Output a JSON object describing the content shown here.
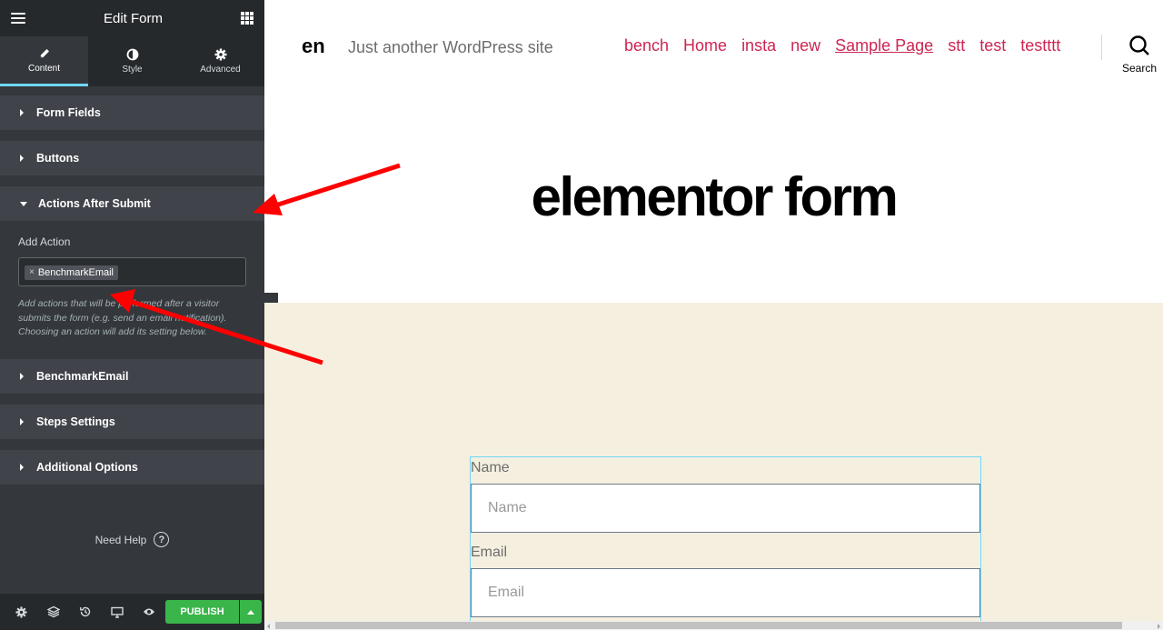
{
  "editor": {
    "title": "Edit Form",
    "tabs": [
      {
        "label": "Content",
        "icon": "pencil-icon"
      },
      {
        "label": "Style",
        "icon": "half-circle-icon"
      },
      {
        "label": "Advanced",
        "icon": "gear-icon"
      }
    ],
    "sections": [
      {
        "label": "Form Fields"
      },
      {
        "label": "Buttons"
      },
      {
        "label": "Actions After Submit"
      },
      {
        "label": "BenchmarkEmail"
      },
      {
        "label": "Steps Settings"
      },
      {
        "label": "Additional Options"
      }
    ],
    "add_action": {
      "label": "Add Action",
      "selected": "BenchmarkEmail",
      "remove_glyph": "×",
      "description": "Add actions that will be performed after a visitor submits the form (e.g. send an email notification). Choosing an action will add its setting below."
    },
    "help": {
      "label": "Need Help",
      "glyph": "?"
    },
    "publish_label": "PUBLISH",
    "colors": {
      "accent": "#71d7f7",
      "publish": "#39b54a",
      "annotation_arrow": "#ff0000"
    }
  },
  "site": {
    "name": "en",
    "tagline": "Just another WordPress site",
    "nav": [
      "bench",
      "Home",
      "insta",
      "new",
      "Sample Page",
      "stt",
      "test",
      "testttt"
    ],
    "current_nav": "Sample Page",
    "search_label": "Search",
    "page_title": "elementor form",
    "form": {
      "fields": [
        {
          "label": "Name",
          "placeholder": "Name"
        },
        {
          "label": "Email",
          "placeholder": "Email"
        }
      ]
    },
    "colors": {
      "link": "#cd2653",
      "content_bg": "#f5efe0"
    }
  }
}
